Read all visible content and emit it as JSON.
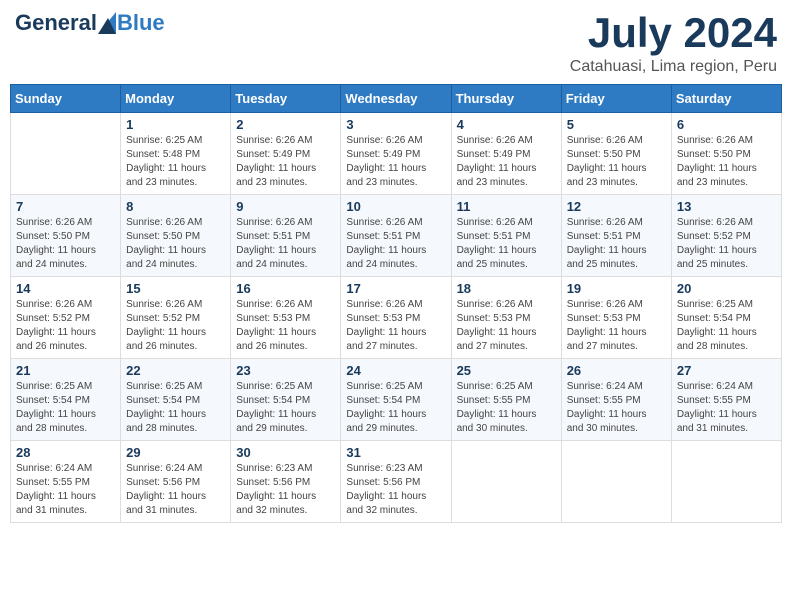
{
  "header": {
    "logo_general": "General",
    "logo_blue": "Blue",
    "month_title": "July 2024",
    "subtitle": "Catahuasi, Lima region, Peru"
  },
  "weekdays": [
    "Sunday",
    "Monday",
    "Tuesday",
    "Wednesday",
    "Thursday",
    "Friday",
    "Saturday"
  ],
  "weeks": [
    [
      {
        "day": "",
        "info": ""
      },
      {
        "day": "1",
        "info": "Sunrise: 6:25 AM\nSunset: 5:48 PM\nDaylight: 11 hours\nand 23 minutes."
      },
      {
        "day": "2",
        "info": "Sunrise: 6:26 AM\nSunset: 5:49 PM\nDaylight: 11 hours\nand 23 minutes."
      },
      {
        "day": "3",
        "info": "Sunrise: 6:26 AM\nSunset: 5:49 PM\nDaylight: 11 hours\nand 23 minutes."
      },
      {
        "day": "4",
        "info": "Sunrise: 6:26 AM\nSunset: 5:49 PM\nDaylight: 11 hours\nand 23 minutes."
      },
      {
        "day": "5",
        "info": "Sunrise: 6:26 AM\nSunset: 5:50 PM\nDaylight: 11 hours\nand 23 minutes."
      },
      {
        "day": "6",
        "info": "Sunrise: 6:26 AM\nSunset: 5:50 PM\nDaylight: 11 hours\nand 23 minutes."
      }
    ],
    [
      {
        "day": "7",
        "info": "Sunrise: 6:26 AM\nSunset: 5:50 PM\nDaylight: 11 hours\nand 24 minutes."
      },
      {
        "day": "8",
        "info": "Sunrise: 6:26 AM\nSunset: 5:50 PM\nDaylight: 11 hours\nand 24 minutes."
      },
      {
        "day": "9",
        "info": "Sunrise: 6:26 AM\nSunset: 5:51 PM\nDaylight: 11 hours\nand 24 minutes."
      },
      {
        "day": "10",
        "info": "Sunrise: 6:26 AM\nSunset: 5:51 PM\nDaylight: 11 hours\nand 24 minutes."
      },
      {
        "day": "11",
        "info": "Sunrise: 6:26 AM\nSunset: 5:51 PM\nDaylight: 11 hours\nand 25 minutes."
      },
      {
        "day": "12",
        "info": "Sunrise: 6:26 AM\nSunset: 5:51 PM\nDaylight: 11 hours\nand 25 minutes."
      },
      {
        "day": "13",
        "info": "Sunrise: 6:26 AM\nSunset: 5:52 PM\nDaylight: 11 hours\nand 25 minutes."
      }
    ],
    [
      {
        "day": "14",
        "info": "Sunrise: 6:26 AM\nSunset: 5:52 PM\nDaylight: 11 hours\nand 26 minutes."
      },
      {
        "day": "15",
        "info": "Sunrise: 6:26 AM\nSunset: 5:52 PM\nDaylight: 11 hours\nand 26 minutes."
      },
      {
        "day": "16",
        "info": "Sunrise: 6:26 AM\nSunset: 5:53 PM\nDaylight: 11 hours\nand 26 minutes."
      },
      {
        "day": "17",
        "info": "Sunrise: 6:26 AM\nSunset: 5:53 PM\nDaylight: 11 hours\nand 27 minutes."
      },
      {
        "day": "18",
        "info": "Sunrise: 6:26 AM\nSunset: 5:53 PM\nDaylight: 11 hours\nand 27 minutes."
      },
      {
        "day": "19",
        "info": "Sunrise: 6:26 AM\nSunset: 5:53 PM\nDaylight: 11 hours\nand 27 minutes."
      },
      {
        "day": "20",
        "info": "Sunrise: 6:25 AM\nSunset: 5:54 PM\nDaylight: 11 hours\nand 28 minutes."
      }
    ],
    [
      {
        "day": "21",
        "info": "Sunrise: 6:25 AM\nSunset: 5:54 PM\nDaylight: 11 hours\nand 28 minutes."
      },
      {
        "day": "22",
        "info": "Sunrise: 6:25 AM\nSunset: 5:54 PM\nDaylight: 11 hours\nand 28 minutes."
      },
      {
        "day": "23",
        "info": "Sunrise: 6:25 AM\nSunset: 5:54 PM\nDaylight: 11 hours\nand 29 minutes."
      },
      {
        "day": "24",
        "info": "Sunrise: 6:25 AM\nSunset: 5:54 PM\nDaylight: 11 hours\nand 29 minutes."
      },
      {
        "day": "25",
        "info": "Sunrise: 6:25 AM\nSunset: 5:55 PM\nDaylight: 11 hours\nand 30 minutes."
      },
      {
        "day": "26",
        "info": "Sunrise: 6:24 AM\nSunset: 5:55 PM\nDaylight: 11 hours\nand 30 minutes."
      },
      {
        "day": "27",
        "info": "Sunrise: 6:24 AM\nSunset: 5:55 PM\nDaylight: 11 hours\nand 31 minutes."
      }
    ],
    [
      {
        "day": "28",
        "info": "Sunrise: 6:24 AM\nSunset: 5:55 PM\nDaylight: 11 hours\nand 31 minutes."
      },
      {
        "day": "29",
        "info": "Sunrise: 6:24 AM\nSunset: 5:56 PM\nDaylight: 11 hours\nand 31 minutes."
      },
      {
        "day": "30",
        "info": "Sunrise: 6:23 AM\nSunset: 5:56 PM\nDaylight: 11 hours\nand 32 minutes."
      },
      {
        "day": "31",
        "info": "Sunrise: 6:23 AM\nSunset: 5:56 PM\nDaylight: 11 hours\nand 32 minutes."
      },
      {
        "day": "",
        "info": ""
      },
      {
        "day": "",
        "info": ""
      },
      {
        "day": "",
        "info": ""
      }
    ]
  ]
}
